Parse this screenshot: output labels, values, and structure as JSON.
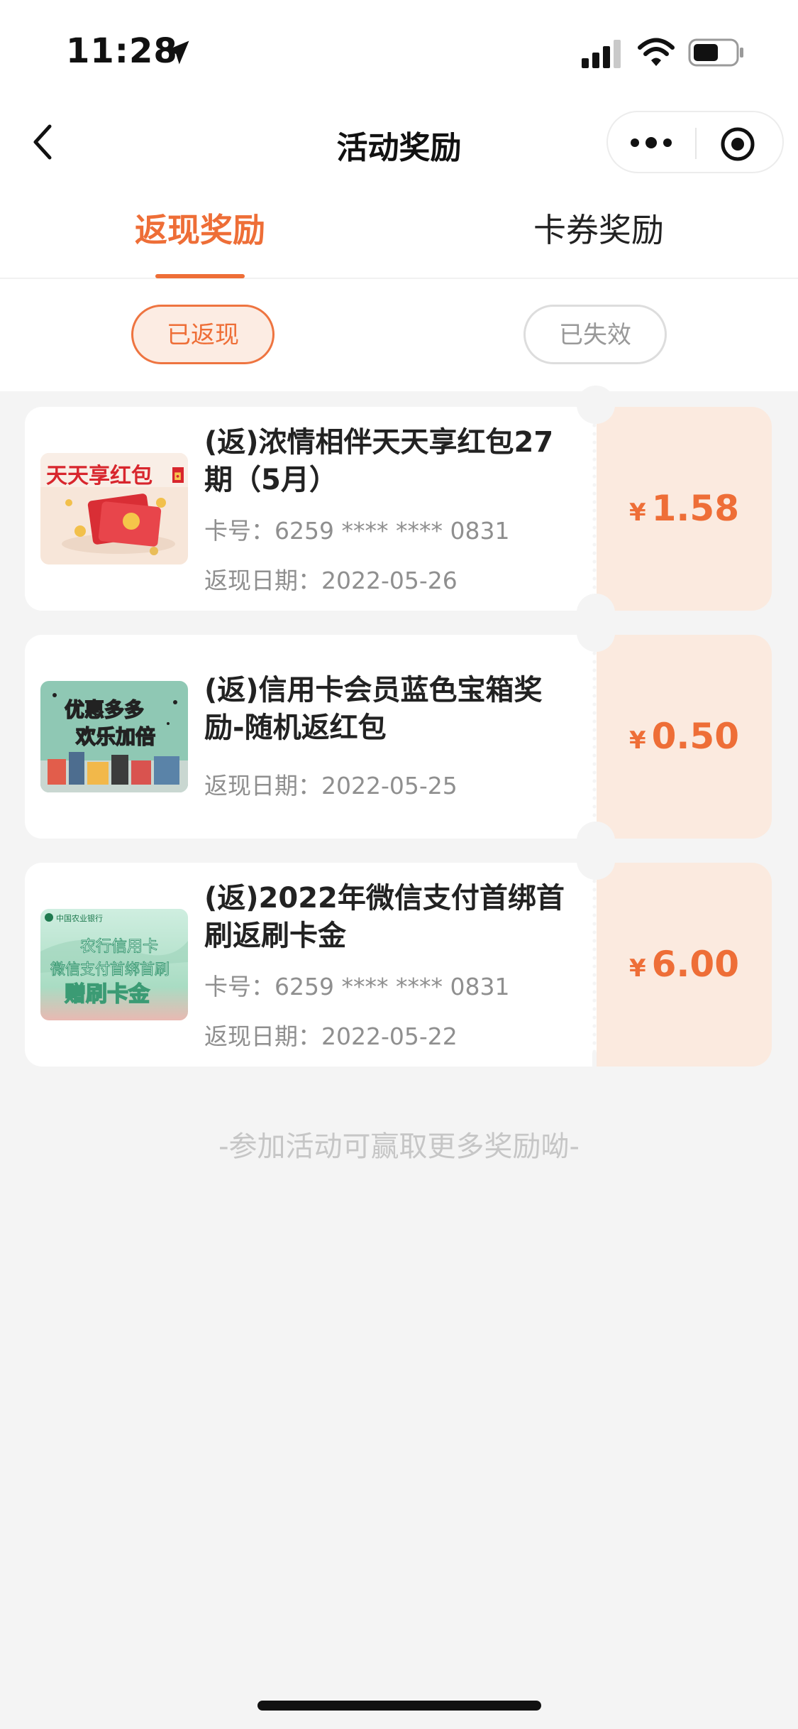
{
  "status_bar": {
    "time": "11:28",
    "battery_level": 0.6
  },
  "nav": {
    "title": "活动奖励"
  },
  "tabs": [
    {
      "label": "返现奖励",
      "active": true
    },
    {
      "label": "卡券奖励",
      "active": false
    }
  ],
  "subtabs": [
    {
      "label": "已返现",
      "active": true
    },
    {
      "label": "已失效",
      "active": false
    }
  ],
  "rewards": [
    {
      "title": "(返)浓情相伴天天享红包27期（5月）",
      "card_no": "卡号：6259 **** **** 0831",
      "date": "返现日期：2022-05-26",
      "currency": "¥",
      "amount": "1.58",
      "thumb_text": "天天享红包",
      "thumb_badge": "◘"
    },
    {
      "title": "(返)信用卡会员蓝色宝箱奖励-随机返红包",
      "date": "返现日期：2022-05-25",
      "currency": "¥",
      "amount": "0.50",
      "thumb_text_1": "优惠多多",
      "thumb_text_2": "欢乐加倍"
    },
    {
      "title": "(返)2022年微信支付首绑首刷返刷卡金",
      "card_no": "卡号：6259 **** **** 0831",
      "date": "返现日期：2022-05-22",
      "currency": "¥",
      "amount": "6.00",
      "thumb_bank": "中国农业银行",
      "thumb_line_1": "农行信用卡",
      "thumb_line_2": "微信支付首绑首刷",
      "thumb_line_3": "赠刷卡金"
    }
  ],
  "footer_note": "-参加活动可赢取更多奖励呦-",
  "colors": {
    "accent": "#ee6e37",
    "amount_bg": "#fbeadf",
    "page_bg": "#f4f4f4"
  }
}
